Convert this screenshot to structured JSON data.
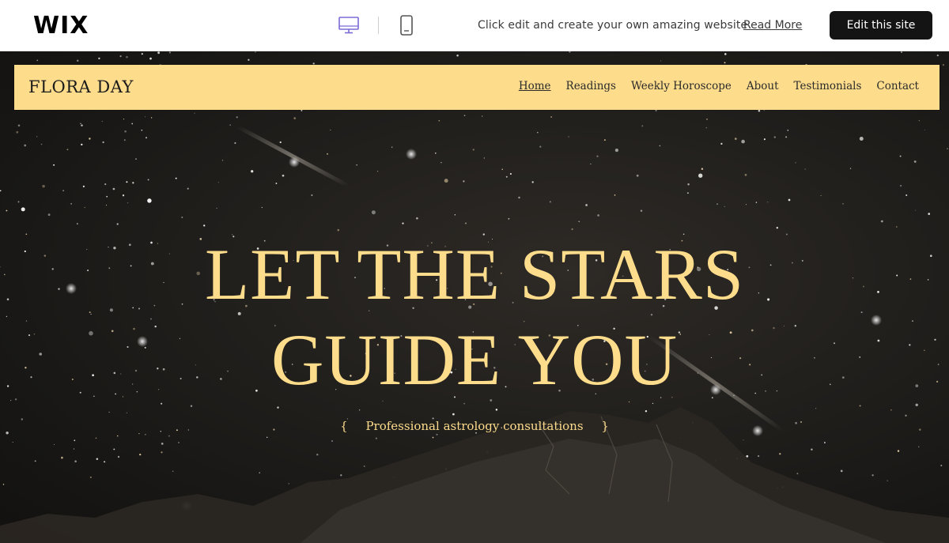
{
  "wix_bar": {
    "logo": "WIX",
    "devices": [
      {
        "name": "desktop-icon",
        "active": true
      },
      {
        "name": "mobile-icon",
        "active": false
      }
    ],
    "promo_text": "Click edit and create your own amazing website",
    "read_more": "Read More",
    "edit_button": "Edit this site"
  },
  "site": {
    "brand": "FLORA DAY",
    "nav": {
      "items": [
        {
          "label": "Home",
          "active": true
        },
        {
          "label": "Readings",
          "active": false
        },
        {
          "label": "Weekly Horoscope",
          "active": false
        },
        {
          "label": "About",
          "active": false
        },
        {
          "label": "Testimonials",
          "active": false
        },
        {
          "label": "Contact",
          "active": false
        }
      ]
    },
    "hero": {
      "headline_line1": "LET THE STARS",
      "headline_line2": "GUIDE YOU",
      "brace_open": "{",
      "tagline": "Professional astrology consultations",
      "brace_close": "}"
    }
  },
  "colors": {
    "accent_gold": "#fddc8c",
    "wix_button": "#141414",
    "device_active": "#7b6bd6"
  }
}
